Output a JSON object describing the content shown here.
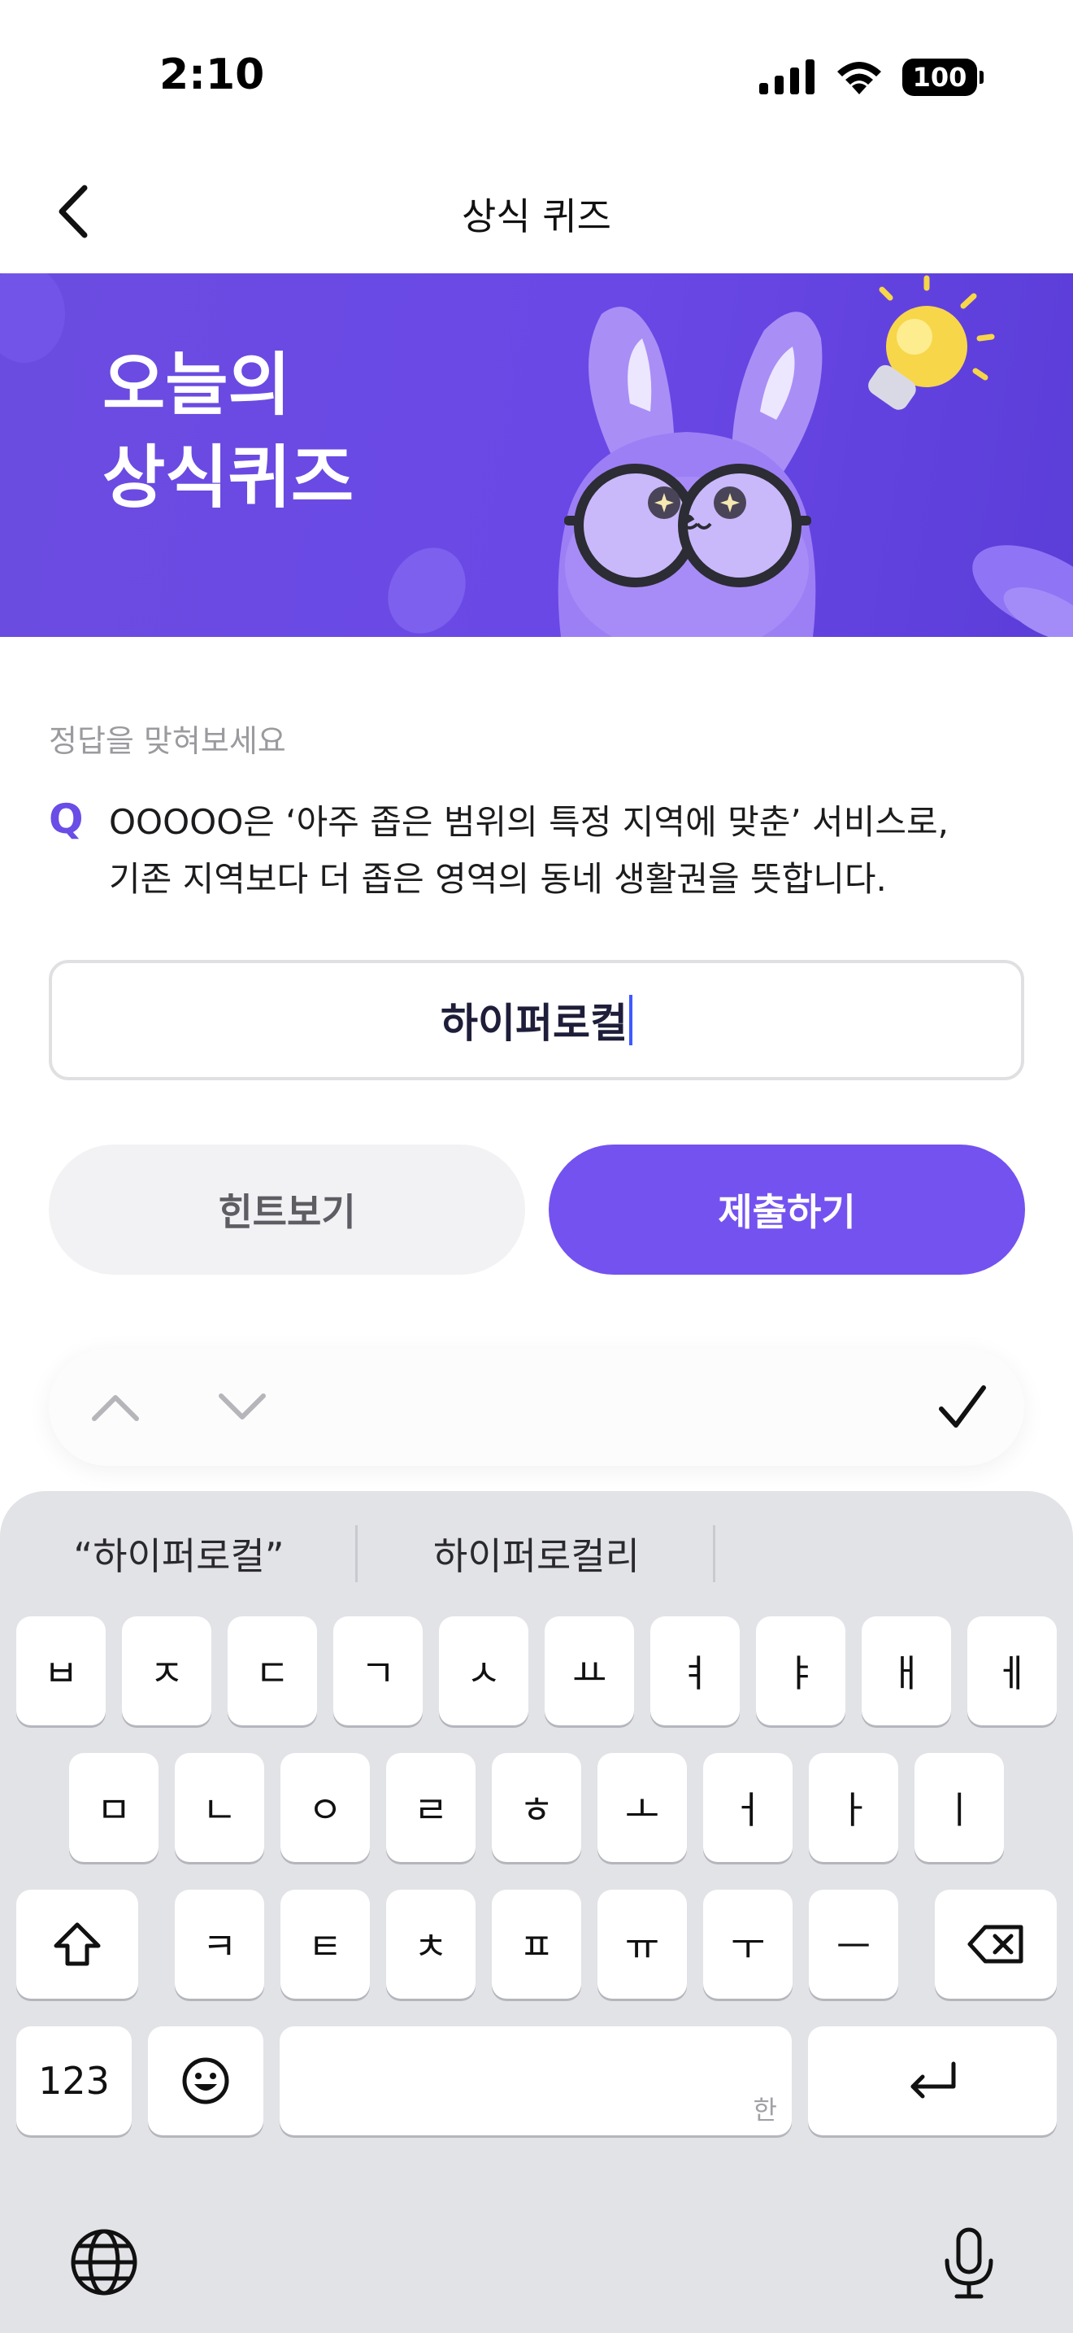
{
  "status": {
    "time": "2:10",
    "battery": "100"
  },
  "nav": {
    "title": "상식 퀴즈"
  },
  "banner": {
    "title_line1": "오늘의",
    "title_line2": "상식퀴즈"
  },
  "question": {
    "hint": "정답을 맞혀보세요",
    "q_mark": "Q",
    "line1": "OOOOO은 ‘아주 좁은 범위의 특정 지역에 맞춘’ 서비스로,",
    "line2": "기존 지역보다 더 좁은 영역의 동네 생활권을 뜻합니다."
  },
  "answer": {
    "value": "하이퍼로컬"
  },
  "buttons": {
    "hint": "힌트보기",
    "submit": "제출하기"
  },
  "keyboard": {
    "suggestions": [
      "“하이퍼로컬”",
      "하이퍼로컬리"
    ],
    "row1": [
      "ㅂ",
      "ㅈ",
      "ㄷ",
      "ㄱ",
      "ㅅ",
      "ㅛ",
      "ㅕ",
      "ㅑ",
      "ㅐ",
      "ㅔ"
    ],
    "row2": [
      "ㅁ",
      "ㄴ",
      "ㅇ",
      "ㄹ",
      "ㅎ",
      "ㅗ",
      "ㅓ",
      "ㅏ",
      "ㅣ"
    ],
    "row3": [
      "ㅋ",
      "ㅌ",
      "ㅊ",
      "ㅍ",
      "ㅠ",
      "ㅜ",
      "ㅡ"
    ],
    "numbers_key": "123",
    "space_hint": "한"
  },
  "colors": {
    "accent": "#7452f0",
    "banner": "#6a48e6"
  }
}
